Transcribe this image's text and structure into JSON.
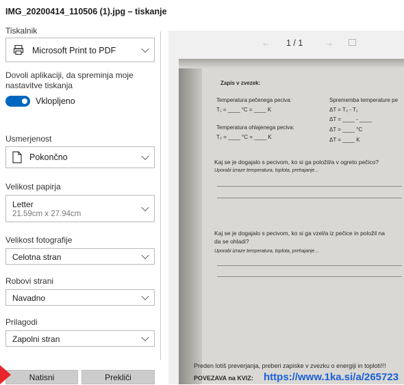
{
  "window": {
    "title": "IMG_20200414_110506 (1).jpg – tiskanje"
  },
  "printer": {
    "label": "Tiskalnik",
    "value": "Microsoft Print to PDF"
  },
  "permission": {
    "text": "Dovoli aplikaciji, da spreminja moje nastavitve tiskanja",
    "toggle_label": "Vklopljeno",
    "toggle_state": true
  },
  "orientation": {
    "label": "Usmerjenost",
    "value": "Pokončno"
  },
  "paper_size": {
    "label": "Velikost papirja",
    "value": "Letter",
    "sub": "21.59cm x 27.94cm"
  },
  "photo_size": {
    "label": "Velikost fotografije",
    "value": "Celotna stran"
  },
  "margins": {
    "label": "Robovi strani",
    "value": "Navadno"
  },
  "fit": {
    "label": "Prilagodi",
    "value": "Zapolni stran"
  },
  "actions": {
    "print": "Natisni",
    "cancel": "Prekliči"
  },
  "preview": {
    "page_counter": "1 / 1",
    "icons": [
      "arrow-left-icon",
      "arrow-right-icon",
      "fit-page-icon"
    ]
  },
  "doc": {
    "heading": "Zapis v zvezek:",
    "t1_label": "Temperatura pečenega peciva:",
    "t1_line": "T₁ = ____ °C = ____ K",
    "change_label": "Sprememba temperature pe",
    "dt1": "ΔT = T₂ - T₁",
    "dt2": "ΔT = ____ - ____",
    "dt3": "ΔT = ____ °C",
    "dt4": "ΔT = ____ K",
    "t2_label": "Temperatura ohlajenega peciva:",
    "t2_line": "T₂ = ____ °C = ____ K",
    "q1": "Kaj se je dogajalo s pecivom, ko si ga položil/a v ogreto pečico?",
    "q1_hint": "Uporabi izraze temperatura, toplota, prehajanje…",
    "q2a": "Kaj se je dogajalo s pecivom, ko si ga vzel/a iz pečice in položil na",
    "q2b": "da se ohladi?",
    "q2_hint": "Uporabi izraze temperatura, toplota, prehajanje…",
    "footer": "Preden lotiš preverjanja, preberi zapiske v zvezku o energiji in toploti!!!",
    "link_prefix": "POVEZAVA na KVIZ:",
    "link": "https://www.1ka.si/a/265723"
  },
  "colors": {
    "accent": "#0067c0",
    "link": "#1a5fd6",
    "pointer_arrow": "#e8262b"
  }
}
